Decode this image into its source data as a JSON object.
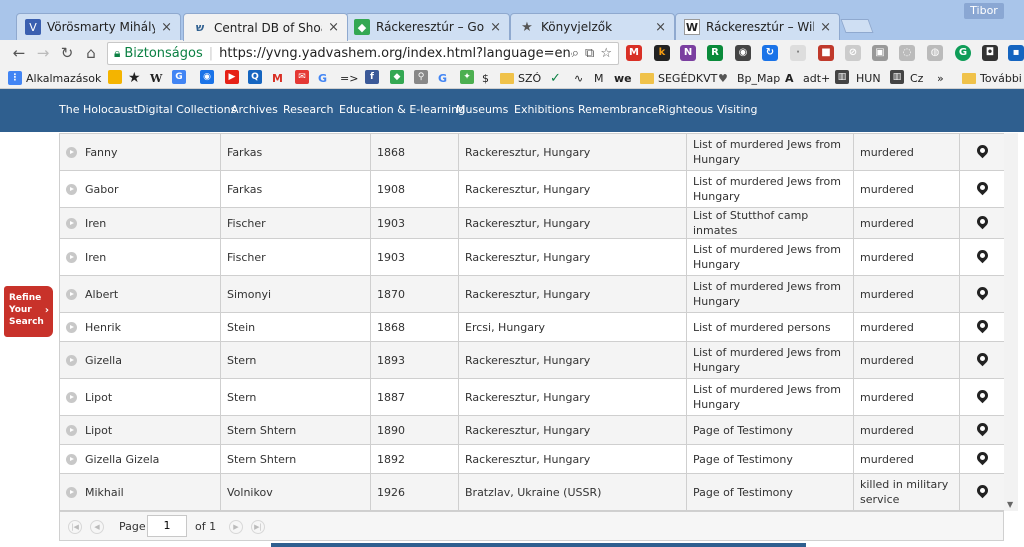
{
  "browser": {
    "tabs": [
      {
        "label": "Vörösmarty Mihály Köny",
        "icon": "vm-icon"
      },
      {
        "label": "Central DB of Shoah Victi",
        "icon": "yadvashem-icon"
      },
      {
        "label": "Ráckeresztúr – Google Té",
        "icon": "maps-icon"
      },
      {
        "label": "Könyvjelzők",
        "icon": "star-icon"
      },
      {
        "label": "Ráckeresztúr – Wikipédia",
        "icon": "wikipedia-icon"
      }
    ],
    "tab_close_symbol": "×",
    "user": "Tibor",
    "secure_label": "Biztonságos",
    "url": "https://yvng.yadvashem.org/index.html?language=en&s_lastN...",
    "bookmarks": {
      "apps": "Alkalmazások",
      "szo": "SZÓ",
      "m": "M",
      "segedkvt": "SEGÉDKVT",
      "bp_map": "Bp_Map",
      "adt": "adt+",
      "hun": "HUN",
      "cz": "Cz",
      "arrow": "=>",
      "dollar": "$",
      "more": "»",
      "other": "További l"
    }
  },
  "site_nav": [
    "The Holocaust",
    "Digital Collections",
    "Archives",
    "Research",
    "Education & E-learning",
    "Museums",
    "Exhibitions",
    "Remembrance",
    "Righteous",
    "Visiting"
  ],
  "refine": [
    "Refine",
    "Your",
    "Search"
  ],
  "rows": [
    {
      "first": "Fanny",
      "last": "Farkas",
      "year": "1868",
      "place": "Rackeresztur, Hungary",
      "source": "List of murdered Jews from Hungary",
      "fate": "murdered"
    },
    {
      "first": "Gabor",
      "last": "Farkas",
      "year": "1908",
      "place": "Rackeresztur, Hungary",
      "source": "List of murdered Jews from Hungary",
      "fate": "murdered"
    },
    {
      "first": "Iren",
      "last": "Fischer",
      "year": "1903",
      "place": "Rackeresztur, Hungary",
      "source": "List of Stutthof camp inmates",
      "fate": "murdered"
    },
    {
      "first": "Iren",
      "last": "Fischer",
      "year": "1903",
      "place": "Rackeresztur, Hungary",
      "source": "List of murdered Jews from Hungary",
      "fate": "murdered"
    },
    {
      "first": "Albert",
      "last": "Simonyi",
      "year": "1870",
      "place": "Rackeresztur, Hungary",
      "source": "List of murdered Jews from Hungary",
      "fate": "murdered"
    },
    {
      "first": "Henrik",
      "last": "Stein",
      "year": "1868",
      "place": "Ercsi, Hungary",
      "source": "List of murdered persons",
      "fate": "murdered"
    },
    {
      "first": "Gizella",
      "last": "Stern",
      "year": "1893",
      "place": "Rackeresztur, Hungary",
      "source": "List of murdered Jews from Hungary",
      "fate": "murdered"
    },
    {
      "first": "Lipot",
      "last": "Stern",
      "year": "1887",
      "place": "Rackeresztur, Hungary",
      "source": "List of murdered Jews from Hungary",
      "fate": "murdered"
    },
    {
      "first": "Lipot",
      "last": "Stern Shtern",
      "year": "1890",
      "place": "Rackeresztur, Hungary",
      "source": "Page of Testimony",
      "fate": "murdered"
    },
    {
      "first": "Gizella Gizela",
      "last": "Stern Shtern",
      "year": "1892",
      "place": "Rackeresztur, Hungary",
      "source": "Page of Testimony",
      "fate": "murdered"
    },
    {
      "first": "Mikhail",
      "last": "Volnikov",
      "year": "1926",
      "place": "Bratzlav, Ukraine (USSR)",
      "source": "Page of Testimony",
      "fate": "killed in military service"
    }
  ],
  "pager": {
    "page_label": "Page",
    "page_value": "1",
    "of_label": "of 1"
  },
  "colors": {
    "nav_bg": "#2f5f8f",
    "refine_bg": "#c8322a",
    "tabstrip_bg": "#a9c5ea"
  }
}
